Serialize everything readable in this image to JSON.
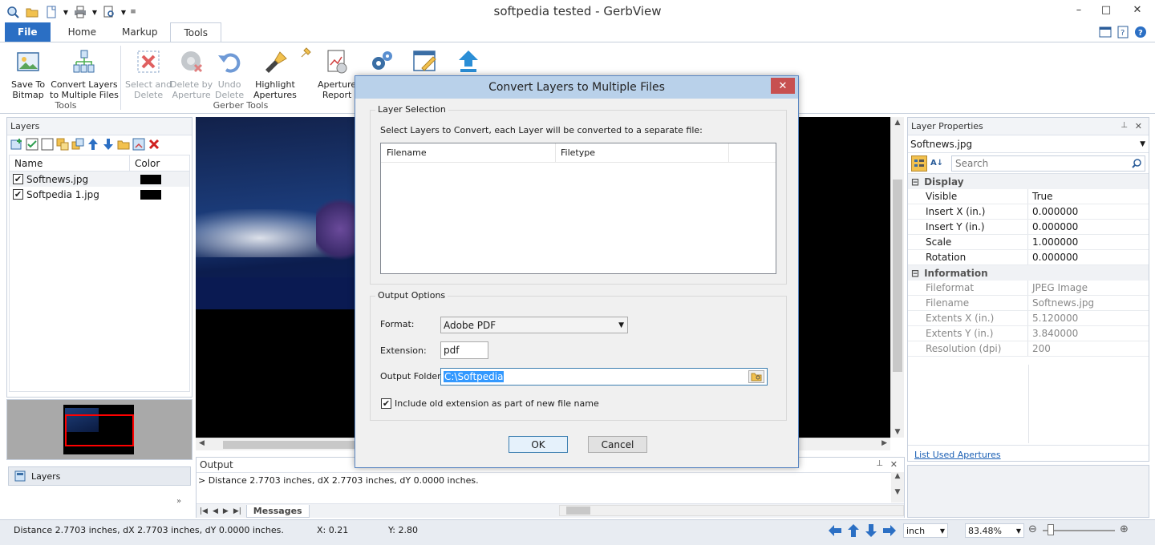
{
  "window": {
    "title": "softpedia tested - GerbView"
  },
  "window_controls": {
    "minimize": "–",
    "maximize": "□",
    "close": "✕"
  },
  "ribbon_tabs": [
    {
      "label": "File"
    },
    {
      "label": "Home"
    },
    {
      "label": "Markup"
    },
    {
      "label": "Tools"
    }
  ],
  "ribbon": {
    "buttons": [
      {
        "line1": "Save To",
        "line2": "Bitmap"
      },
      {
        "line1": "Convert Layers",
        "line2": "to Multiple Files"
      },
      {
        "line1": "Select and",
        "line2": "Delete"
      },
      {
        "line1": "Delete by",
        "line2": "Aperture"
      },
      {
        "line1": "Undo",
        "line2": "Delete"
      },
      {
        "line1": "Highlight",
        "line2": "Apertures"
      },
      {
        "line1": "Aperture",
        "line2": "Report"
      }
    ],
    "groups": {
      "tools": "Tools",
      "gerber_tools": "Gerber Tools"
    }
  },
  "layers_panel": {
    "title": "Layers",
    "columns": [
      "Name",
      "Color"
    ],
    "rows": [
      {
        "name": "Softnews.jpg",
        "checked": true,
        "color": "#000000"
      },
      {
        "name": "Softpedia 1.jpg",
        "checked": true,
        "color": "#000000"
      }
    ],
    "tab_label": "Layers"
  },
  "output_panel": {
    "title": "Output",
    "message": "> Distance 2.7703 inches, dX 2.7703 inches, dY 0.0000 inches.",
    "tab_label": "Messages"
  },
  "properties_panel": {
    "title": "Layer Properties",
    "selected_layer": "Softnews.jpg",
    "search_placeholder": "Search",
    "display_category": "Display",
    "display_rows": [
      {
        "key": "Visible",
        "value": "True"
      },
      {
        "key": "Insert X (in.)",
        "value": "0.000000"
      },
      {
        "key": "Insert Y (in.)",
        "value": "0.000000"
      },
      {
        "key": "Scale",
        "value": "1.000000"
      },
      {
        "key": "Rotation",
        "value": "0.000000"
      }
    ],
    "info_category": "Information",
    "info_rows": [
      {
        "key": "Fileformat",
        "value": "JPEG Image"
      },
      {
        "key": "Filename",
        "value": "Softnews.jpg"
      },
      {
        "key": "Extents X (in.)",
        "value": "5.120000"
      },
      {
        "key": "Extents Y (in.)",
        "value": "3.840000"
      },
      {
        "key": "Resolution (dpi)",
        "value": "200"
      }
    ],
    "link": "List Used Apertures"
  },
  "status_bar": {
    "message": "Distance 2.7703 inches, dX 2.7703 inches, dY 0.0000 inches.",
    "x": "X: 0.21",
    "y": "Y: 2.80",
    "units": "inch",
    "zoom": "83.48%"
  },
  "dialog": {
    "title": "Convert Layers to Multiple Files",
    "layer_selection_legend": "Layer Selection",
    "instruction": "Select Layers to Convert, each Layer will be converted to a separate file:",
    "list_columns": [
      "Filename",
      "Filetype"
    ],
    "output_options_legend": "Output Options",
    "format_label": "Format:",
    "format_value": "Adobe PDF",
    "extension_label": "Extension:",
    "extension_value": "pdf",
    "folder_label": "Output Folder:",
    "folder_value": "C:\\Softpedia",
    "include_ext_label": "Include old extension as part of new file name",
    "include_ext_checked": true,
    "ok_label": "OK",
    "cancel_label": "Cancel"
  },
  "colors": {
    "accent": "#2b6fc4",
    "selection": "#3399ff",
    "close": "#c75050",
    "viewport_frame": "#ff0000"
  }
}
